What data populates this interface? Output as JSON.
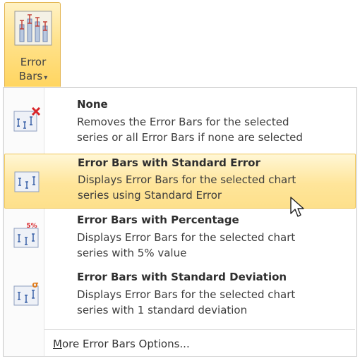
{
  "ribbon": {
    "button_label_line1": "Error",
    "button_label_line2": "Bars",
    "dropdown_arrow": "▾",
    "icon": "error-bars-chart-icon"
  },
  "menu": {
    "items": [
      {
        "icon": "error-bars-none-icon",
        "title": "None",
        "desc_line1": "Removes the Error Bars for the selected",
        "desc_line2": "series or all Error Bars if none are selected"
      },
      {
        "icon": "error-bars-standard-error-icon",
        "title": "Error Bars with Standard Error",
        "desc_line1": "Displays Error Bars for the selected chart",
        "desc_line2": "series using Standard Error",
        "highlighted": true
      },
      {
        "icon": "error-bars-percentage-icon",
        "icon_text": "5%",
        "title": "Error Bars with Percentage",
        "desc_line1": "Displays Error Bars for the selected chart",
        "desc_line2": "series with 5% value"
      },
      {
        "icon": "error-bars-standard-deviation-icon",
        "icon_text": "σ",
        "title": "Error Bars with Standard Deviation",
        "desc_line1": "Displays Error Bars for the selected chart",
        "desc_line2": "series with 1 standard deviation"
      }
    ],
    "more_options": {
      "accel": "M",
      "rest": "ore Error Bars Options..."
    }
  },
  "colors": {
    "highlight_top": "#fff7d6",
    "highlight_bottom": "#fde08b",
    "highlight_border": "#efc65a",
    "icon_red": "#d8262b",
    "icon_blue": "#3b63a8",
    "icon_orange": "#e07b1a"
  }
}
